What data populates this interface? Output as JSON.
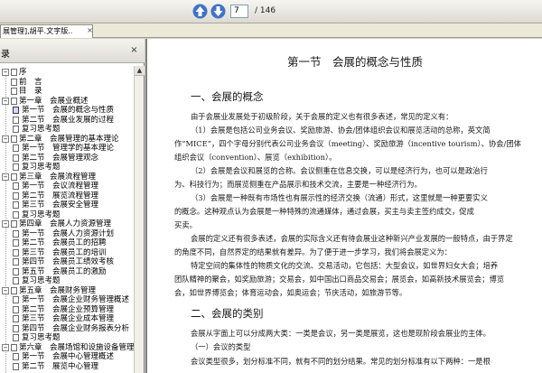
{
  "toolbar": {
    "page_current": "7",
    "page_total": "/ 146"
  },
  "tab": {
    "title": "展管理],胡平.文字版..",
    "close": "×"
  },
  "sidebar": {
    "title": "录",
    "close": "×",
    "scroll_up": "▲",
    "items": [
      {
        "expander": "−",
        "label": "序"
      },
      {
        "expander": "",
        "label": "前　言"
      },
      {
        "expander": "",
        "label": "目　录"
      },
      {
        "expander": "−",
        "label": "第一章　会展业概述"
      },
      {
        "expander": "",
        "label": "第一节　会展的概念与性质"
      },
      {
        "expander": "",
        "label": "第二节　会展业发展的过程"
      },
      {
        "expander": "",
        "label": "复习思考题"
      },
      {
        "expander": "−",
        "label": "第二章　会展管理的基本理论"
      },
      {
        "expander": "",
        "label": "第一节　管理学的基本理论"
      },
      {
        "expander": "",
        "label": "第二节　会展管理观念"
      },
      {
        "expander": "",
        "label": "复习思考题"
      },
      {
        "expander": "−",
        "label": "第三章　会展流程管理"
      },
      {
        "expander": "",
        "label": "第一节　会议流程管理"
      },
      {
        "expander": "",
        "label": "第二节　展览流程管理"
      },
      {
        "expander": "",
        "label": "第三节　会展安全管理"
      },
      {
        "expander": "",
        "label": "复习思考题"
      },
      {
        "expander": "−",
        "label": "第四章　会展人力资源管理"
      },
      {
        "expander": "",
        "label": "第一节　会展人力资源计划"
      },
      {
        "expander": "",
        "label": "第二节　会展员工的招聘"
      },
      {
        "expander": "",
        "label": "第三节　会展员工的培训"
      },
      {
        "expander": "",
        "label": "第四节　会展员工绩效考核"
      },
      {
        "expander": "",
        "label": "第五节　会展员工的激励"
      },
      {
        "expander": "",
        "label": "复习思考题"
      },
      {
        "expander": "−",
        "label": "第五章　会展财务管理"
      },
      {
        "expander": "",
        "label": "第一节　会展企业财务管理概述"
      },
      {
        "expander": "",
        "label": "第二节　会展企业预算管理"
      },
      {
        "expander": "",
        "label": "第三节　会展企业成本管理"
      },
      {
        "expander": "",
        "label": "第四节　会展企业财务报表分析"
      },
      {
        "expander": "",
        "label": "复习思考题"
      },
      {
        "expander": "−",
        "label": "第六章　会展场馆和设施设备管理"
      },
      {
        "expander": "",
        "label": "第一节　会展中心管理概述"
      },
      {
        "expander": "",
        "label": "第二节　展览中心管理"
      }
    ]
  },
  "document": {
    "section_title": "第一节　会展的概念与性质",
    "heading1": "一、会展的概念",
    "paragraphs": [
      "由于会展业发展处于初级阶段，关于会展的定义也有很多表述，常见的定义有：",
      "（1）会展是包括公司业务会议、奖励旅游、协会/团体组织会议和展览活动的总称，英文简",
      "作“MICE”，四个字母分别代表公司业务会议（meeting）、奖励旅游（incentive tourism）、协会/团体",
      "组织会议（convention）、展览（exhibition）。",
      "（2）会展是会议和展览的合称。会议侧重在信息交换，可以是经济行为，也可以是政治行",
      "为、科技行为；而展览侧重在产品展示和技术交流，主要是一种经济行为。",
      "（3）会展是一种既有市场性也有展示性的经济交换（流通）形式，这里就是一种更要实义",
      "的概念。这种观点认为会展是一种特殊的流通媒体，通过会展，买主与卖主签约成交，促成",
      "买卖。",
      "会展的定义还有很多表述，会展的实际含义还有待会展业这种新兴产业发展的一般特点，由于界定",
      "的角度不同，自然界定的结果就有差异。为了便于进一步学习，我们将会展定义为：",
      "特定空间的集体性的物质文化的交流、交易活动，它包括：大型会议，如世界妇女大会；培养",
      "团队精神的聚会，如奖励旅游；交易会，如中国出口商品交易会；展览会，如高新技术展览会；博览",
      "会，如世界博览会；体育运动会，如奥运会；节庆活动，如旅游节等。"
    ],
    "heading2": "二、会展的类别",
    "paragraphs2": [
      "会展从字面上可以分成两大类：一类是会议，另一类是展览，这也是现阶段会展业的主体。",
      "（一）会议的类型",
      "会议类型很多，划分标准不同，就有不同的划分结果。常见的划分标准有以下两种：一是根"
    ]
  }
}
